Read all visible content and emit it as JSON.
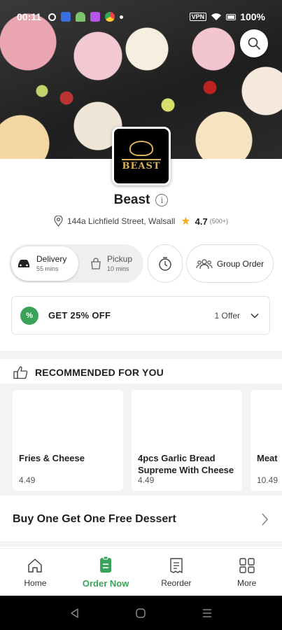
{
  "status_bar": {
    "time": "00:11",
    "vpn": "VPN",
    "battery": "100%"
  },
  "restaurant": {
    "logo_text": "BEAST",
    "name": "Beast",
    "address": "144a Lichfield Street, Walsall",
    "rating": "4.7",
    "reviews": "(500+)"
  },
  "order_mode": {
    "delivery_label": "Delivery",
    "delivery_time": "55 mins",
    "pickup_label": "Pickup",
    "pickup_time": "10 mins",
    "selected": "Delivery"
  },
  "group_order_label": "Group Order",
  "offer": {
    "badge": "%",
    "title": "GET 25% OFF",
    "count": "1 Offer"
  },
  "recommended": {
    "title": "RECOMMENDED FOR YOU",
    "items": [
      {
        "name": "Fries & Cheese",
        "price": "4.49"
      },
      {
        "name": "4pcs Garlic Bread Supreme With Cheese",
        "price": "4.49"
      },
      {
        "name": "Meat",
        "price": "10.49"
      }
    ]
  },
  "promo_banner": "Buy One Get One Free Dessert",
  "tabs": [
    {
      "label": "Home",
      "icon": "home-icon"
    },
    {
      "label": "Order Now",
      "icon": "order-icon",
      "active": true
    },
    {
      "label": "Reorder",
      "icon": "receipt-icon"
    },
    {
      "label": "More",
      "icon": "grid-icon"
    }
  ],
  "colors": {
    "accent": "#3aa35a",
    "star": "#f2b01e"
  }
}
